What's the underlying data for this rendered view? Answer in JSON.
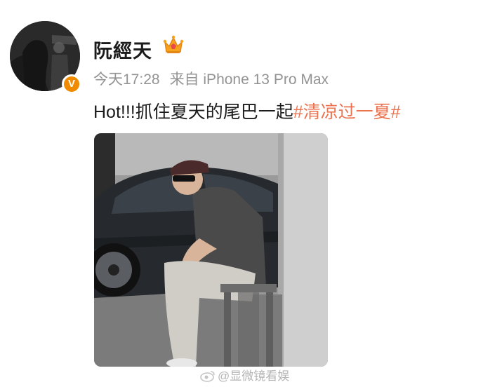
{
  "post": {
    "username": "阮經天",
    "time": "今天17:28",
    "source": "来自 iPhone 13 Pro Max",
    "text_plain": "Hot!!!抓住夏天的尾巴一起",
    "hashtag": "#清凉过一夏#",
    "verified_mark": "V"
  },
  "watermark": {
    "text": "@显微镜看娱"
  },
  "colors": {
    "hashtag": "#eb7350",
    "meta": "#939393",
    "verified": "#f08a00"
  },
  "icons": [
    "crown-icon",
    "verified-badge",
    "weibo-icon"
  ]
}
